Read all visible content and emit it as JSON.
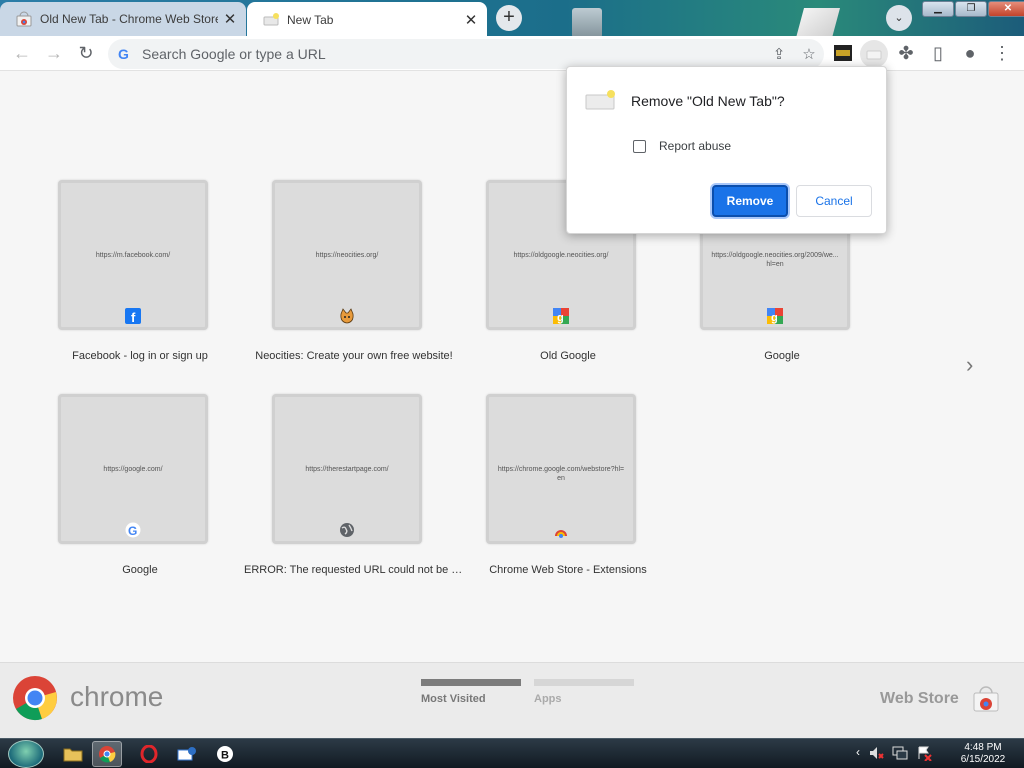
{
  "tabs": [
    {
      "title": "Old New Tab - Chrome Web Store",
      "close": "✕",
      "active": false
    },
    {
      "title": "New Tab",
      "close": "✕",
      "active": true
    }
  ],
  "tabstrip": {
    "new_tab": "+",
    "tab_search": "⌄"
  },
  "window_controls": {
    "minimize": "▁",
    "maximize": "❐",
    "close": "✕"
  },
  "toolbar": {
    "back": "←",
    "forward": "→",
    "reload": "↻",
    "omnibox_placeholder": "Search Google or type a URL",
    "share": "⇪",
    "bookmark": "☆",
    "extensions": "✤",
    "side_panel": "▯",
    "profile": "●",
    "menu": "⋮"
  },
  "tiles": [
    {
      "url": "https://m.facebook.com/",
      "title": "Facebook - log in or sign up",
      "icon": "facebook-icon"
    },
    {
      "url": "https://neocities.org/",
      "title": "Neocities: Create your own free website!",
      "icon": "neocities-cat-icon"
    },
    {
      "url": "https://oldgoogle.neocities.org/",
      "title": "Old Google",
      "icon": "old-google-icon"
    },
    {
      "url": "https://oldgoogle.neocities.org/2009/we... hl=en",
      "title": "Google",
      "icon": "old-google-icon"
    },
    {
      "url": "https://google.com/",
      "title": "Google",
      "icon": "google-g-icon"
    },
    {
      "url": "https://therestartpage.com/",
      "title": "ERROR: The requested URL could not be retrieved",
      "icon": "globe-icon"
    },
    {
      "url": "https://chrome.google.com/webstore?hl=en",
      "title": "Chrome Web Store - Extensions",
      "icon": "chrome-webstore-icon"
    }
  ],
  "page": {
    "next_arrow": "›"
  },
  "bottom_bar": {
    "brand": "chrome",
    "sections": [
      {
        "label": "Most Visited",
        "active": true
      },
      {
        "label": "Apps",
        "active": false
      }
    ],
    "webstore": "Web Store"
  },
  "dialog": {
    "title": "Remove \"Old New Tab\"?",
    "checkbox_label": "Report abuse",
    "checkbox_checked": false,
    "primary_button": "Remove",
    "secondary_button": "Cancel"
  },
  "taskbar": {
    "time": "4:48 PM",
    "date": "6/15/2022",
    "tray_chevron": "‹"
  },
  "colors": {
    "accent": "#1a73e8",
    "taskbar": "#1c2731"
  }
}
